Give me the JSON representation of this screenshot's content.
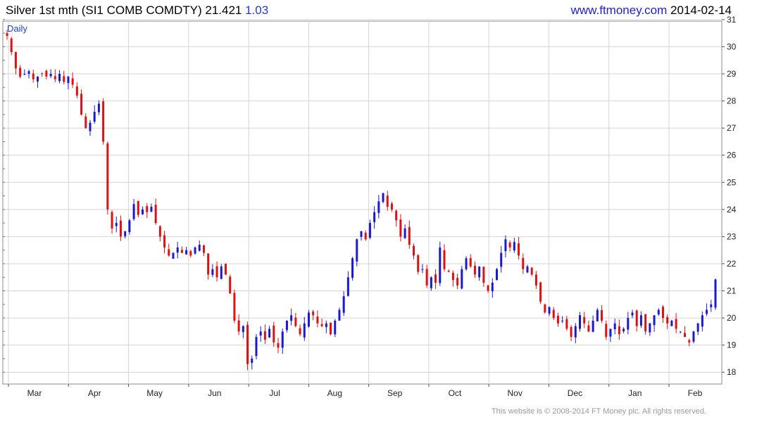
{
  "header": {
    "title_main": "Silver 1st mth (SI1 COMB COMDTY) 21.421",
    "change": "1.03",
    "site": "www.ftmoney.com",
    "date": "2014-02-14"
  },
  "footer": {
    "copyright": "This website is © 2008-2014 FT Money plc. All rights reserved."
  },
  "colors": {
    "up": "#1a1acc",
    "down": "#dd1111",
    "grid": "#d4d4d4",
    "frame": "#888888"
  },
  "chart_data": {
    "type": "candlestick",
    "period_label": "Daily",
    "x_tick_labels": [
      "Mar",
      "Apr",
      "May",
      "Jun",
      "Jul",
      "Aug",
      "Sep",
      "Oct",
      "Nov",
      "Dec",
      "Jan",
      "Feb"
    ],
    "y_tick_values": [
      18,
      19,
      20,
      21,
      22,
      23,
      24,
      25,
      26,
      27,
      28,
      29,
      30,
      31
    ],
    "ylim": [
      17.85,
      31.1
    ],
    "last": 21.421,
    "change": 1.03,
    "grid": true,
    "close_path": [
      30.4,
      29.8,
      29.2,
      28.9,
      29.0,
      29.1,
      28.8,
      28.9,
      29.0,
      28.9,
      29.0,
      28.8,
      29.0,
      28.7,
      28.9,
      28.6,
      28.2,
      27.5,
      27.0,
      27.2,
      27.6,
      27.9,
      26.5,
      24.0,
      23.3,
      23.5,
      23.0,
      23.2,
      23.6,
      24.2,
      23.8,
      24.0,
      23.9,
      24.1,
      23.5,
      23.0,
      22.6,
      22.3,
      22.4,
      22.6,
      22.4,
      22.5,
      22.3,
      22.6,
      22.7,
      22.4,
      21.6,
      21.8,
      21.5,
      21.9,
      21.6,
      20.9,
      19.9,
      19.5,
      19.7,
      18.3,
      18.5,
      19.3,
      19.5,
      19.2,
      19.6,
      19.1,
      18.9,
      19.5,
      19.9,
      20.1,
      19.7,
      19.4,
      19.8,
      20.2,
      20.1,
      19.8,
      19.7,
      19.8,
      19.4,
      19.9,
      20.3,
      20.8,
      21.5,
      22.2,
      22.9,
      23.2,
      22.9,
      23.5,
      23.9,
      24.3,
      24.6,
      24.1,
      24.0,
      23.6,
      23.0,
      23.3,
      22.7,
      22.3,
      21.7,
      21.8,
      21.2,
      21.5,
      21.3,
      22.6,
      21.8,
      21.7,
      21.4,
      21.2,
      21.8,
      22.2,
      21.9,
      21.6,
      21.9,
      21.3,
      21.0,
      21.3,
      21.8,
      22.4,
      22.9,
      22.6,
      22.8,
      22.3,
      21.8,
      21.9,
      21.6,
      21.2,
      20.6,
      20.2,
      20.4,
      20.0,
      19.8,
      19.9,
      19.6,
      19.3,
      19.7,
      20.1,
      19.8,
      19.5,
      19.9,
      20.3,
      19.9,
      19.3,
      19.6,
      19.8,
      19.4,
      19.6,
      20.0,
      20.2,
      19.7,
      20.1,
      19.5,
      19.8,
      20.1,
      20.3,
      20.0,
      19.8,
      19.9,
      19.6,
      19.5,
      19.3,
      19.1,
      19.5,
      19.8,
      20.1,
      20.3,
      20.5,
      21.421
    ]
  }
}
